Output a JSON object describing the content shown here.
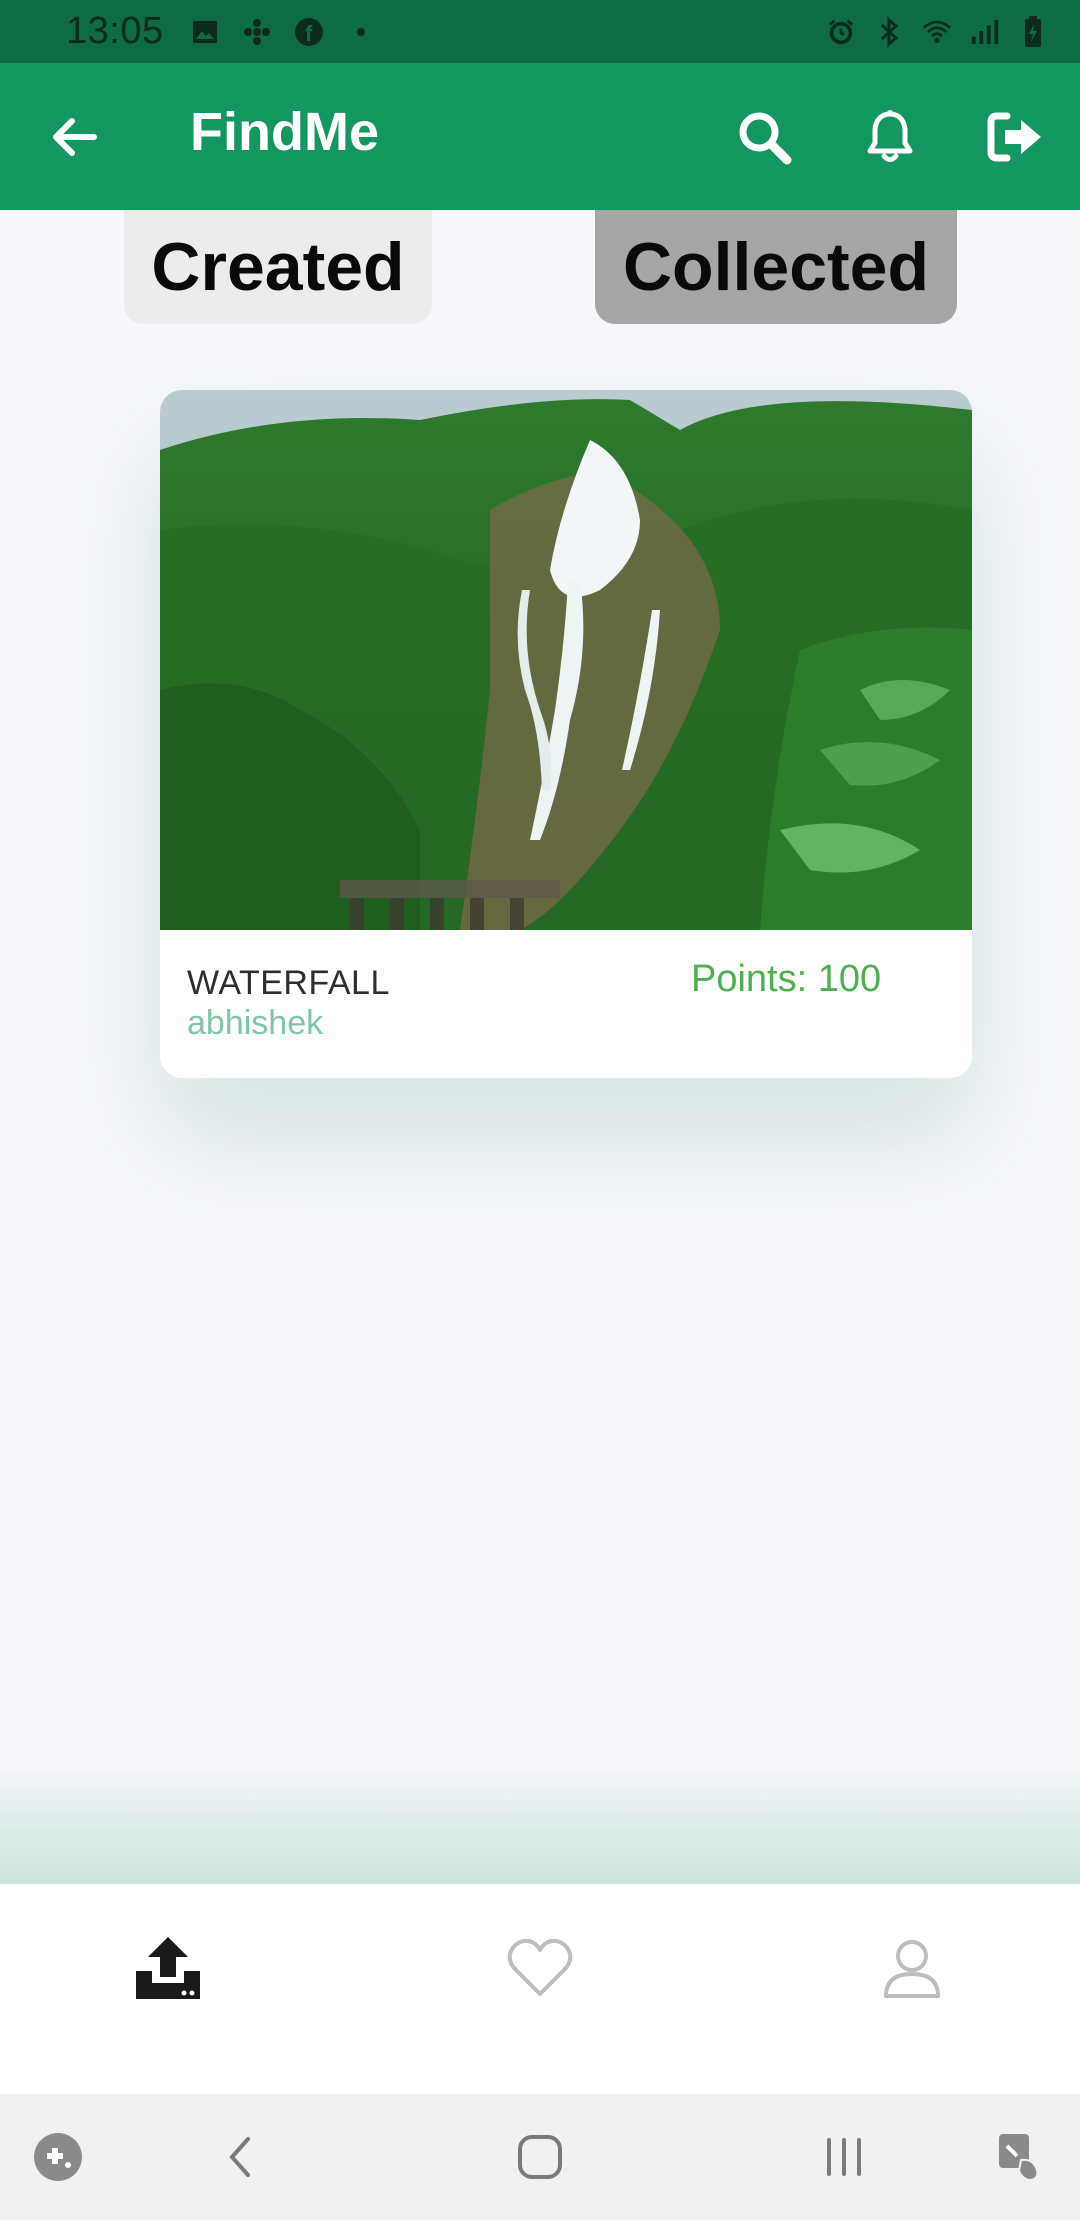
{
  "status_bar": {
    "time": "13:05",
    "left_icons": [
      "gallery-icon",
      "pinwheel-icon",
      "facebook-icon",
      "dot-icon"
    ],
    "right_icons": [
      "alarm-icon",
      "bluetooth-icon",
      "wifi-icon",
      "signal-icon",
      "battery-icon"
    ]
  },
  "app_bar": {
    "title": "FindMe",
    "color": "#13965f"
  },
  "tabs": [
    {
      "label": "Created",
      "selected": false
    },
    {
      "label": "Collected",
      "selected": true
    }
  ],
  "card": {
    "title": "WATERFALL",
    "author": "abhishek",
    "points": "Points: 100"
  },
  "bottom_nav": {
    "items": [
      "upload-icon",
      "heart-icon",
      "profile-icon"
    ]
  },
  "system_nav": {
    "items": [
      "game-launcher-icon",
      "back-icon",
      "home-icon",
      "recents-icon",
      "assistant-icon"
    ]
  }
}
